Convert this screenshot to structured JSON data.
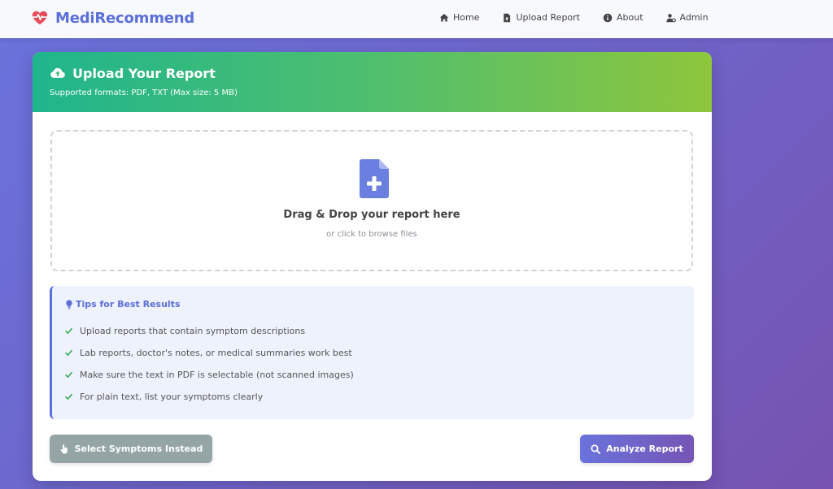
{
  "app": {
    "brand": "MediRecommend",
    "brand_color": "#5b6fd9"
  },
  "nav": {
    "items": [
      {
        "label": "Home",
        "icon": "home-icon"
      },
      {
        "label": "Upload Report",
        "icon": "file-upload-icon"
      },
      {
        "label": "About",
        "icon": "info-icon"
      },
      {
        "label": "Admin",
        "icon": "user-cog-icon"
      }
    ]
  },
  "upload_card": {
    "title": "Upload Your Report",
    "subtitle": "Supported formats: PDF, TXT (Max size: 5 MB)",
    "title_icon": "cloud-upload-icon",
    "header_gradient": [
      "#1fb58c",
      "#8ec63c"
    ]
  },
  "dropzone": {
    "title": "Drag & Drop your report here",
    "subtitle": "or click to browse files",
    "icon": "file-plus-icon"
  },
  "tips": {
    "title": "Tips for Best Results",
    "icon": "lightbulb-icon",
    "items": [
      "Upload reports that contain symptom descriptions",
      "Lab reports, doctor's notes, or medical summaries work best",
      "Make sure the text in PDF is selectable (not scanned images)",
      "For plain text, list your symptoms clearly"
    ]
  },
  "actions": {
    "select_symptoms_label": "Select Symptoms Instead",
    "analyze_label": "Analyze Report",
    "select_color": "#95a5a6",
    "analyze_color": "#6a73dc"
  }
}
